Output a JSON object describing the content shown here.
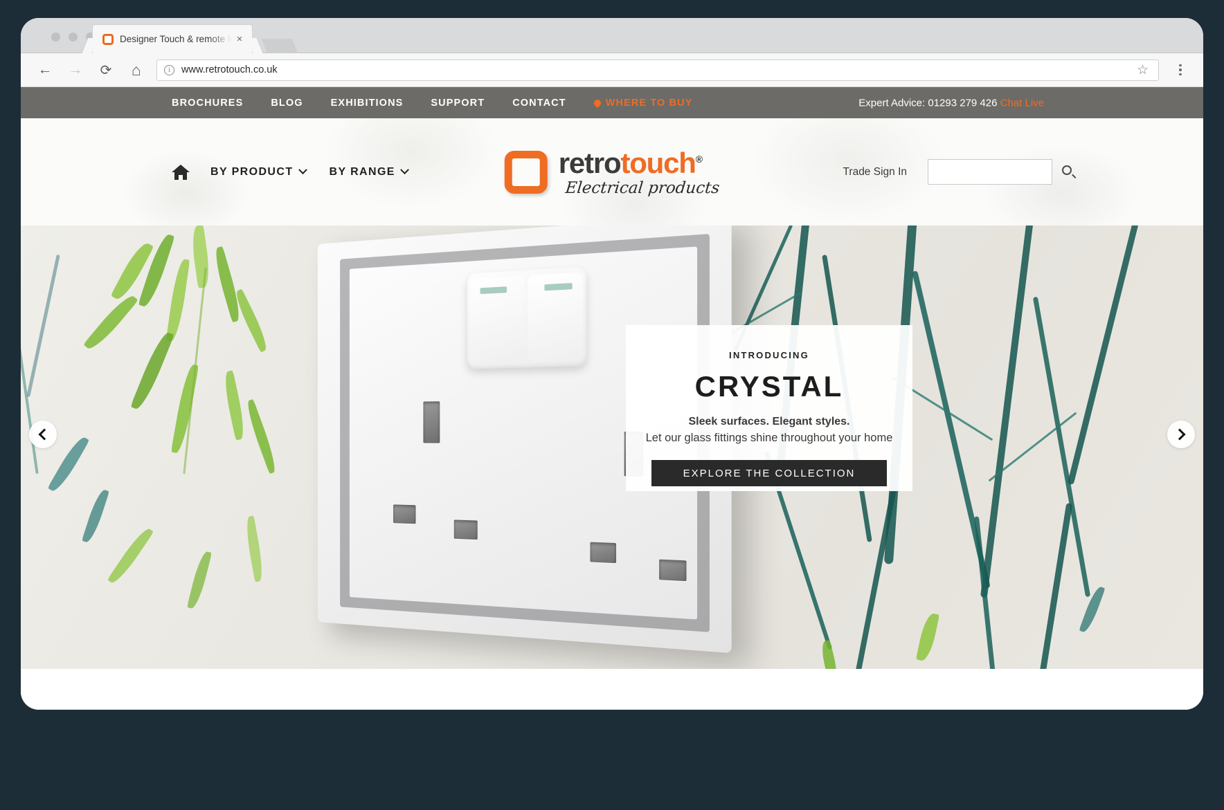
{
  "browser": {
    "tab_title": "Designer Touch & remote light",
    "tab_close": "×",
    "url": "www.retrotouch.co.uk",
    "back_icon": "←",
    "forward_icon": "→",
    "reload_icon": "⟳",
    "home_icon": "⌂",
    "info_icon": "i",
    "bookmark_icon": "☆"
  },
  "topbar": {
    "links": [
      {
        "label": "BROCHURES"
      },
      {
        "label": "BLOG"
      },
      {
        "label": "EXHIBITIONS"
      },
      {
        "label": "SUPPORT"
      },
      {
        "label": "CONTACT"
      }
    ],
    "where_to_buy": "WHERE TO BUY",
    "advice_prefix": "Expert Advice: 01293 279 426",
    "chat_live": "Chat Live",
    "bg_color": "#6c6b68",
    "accent_color": "#ef6c23"
  },
  "header": {
    "menu": [
      {
        "label": "BY PRODUCT"
      },
      {
        "label": "BY RANGE"
      }
    ],
    "logo": {
      "word_a": "retro",
      "word_b": "touch",
      "registered": "®",
      "tagline": "Electrical products",
      "brand_color": "#ef6c23"
    },
    "trade_sign_in": "Trade Sign In",
    "search_value": "",
    "search_placeholder": ""
  },
  "hero": {
    "card": {
      "kicker": "INTRODUCING",
      "headline": "CRYSTAL",
      "sub_bold": "Sleek surfaces. Elegant styles.",
      "sub_light": "Let our glass fittings shine throughout your home",
      "cta_label": "EXPLORE THE COLLECTION"
    },
    "prev_label": "Previous slide",
    "next_label": "Next slide"
  }
}
